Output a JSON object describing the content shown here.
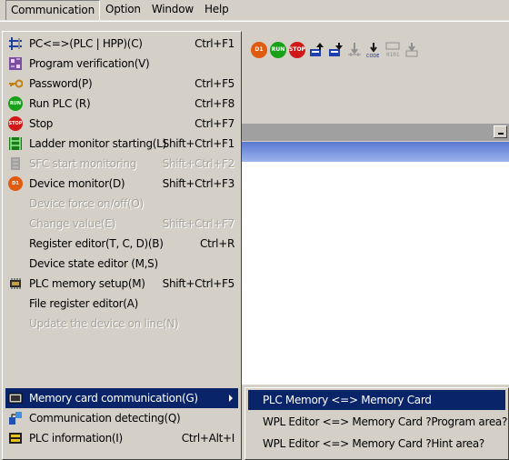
{
  "menubar": {
    "items": [
      {
        "label": "Communication",
        "open": true
      },
      {
        "label": "Option"
      },
      {
        "label": "Window"
      },
      {
        "label": "Help"
      }
    ]
  },
  "toolbar": {
    "icons": [
      "device-monitor-icon",
      "run-plc-icon",
      "stop-plc-icon",
      "upload-icon",
      "download-icon",
      "monitor-write-icon",
      "code-write-icon",
      "bit-write-icon",
      "transfer-icon"
    ]
  },
  "communication_menu": {
    "items": [
      {
        "label": "PC<=>(PLC | HPP)(C)",
        "shortcut": "Ctrl+F1",
        "icon": "pc-plc-transfer-icon",
        "enabled": true
      },
      {
        "label": "Program verification(V)",
        "shortcut": "",
        "icon": "program-verify-icon",
        "enabled": true
      },
      {
        "label": "Password(P)",
        "shortcut": "Ctrl+F5",
        "icon": "key-icon",
        "enabled": true
      },
      {
        "label": "Run PLC (R)",
        "shortcut": "Ctrl+F8",
        "icon": "run-icon",
        "icon_text": "RUN",
        "enabled": true
      },
      {
        "label": "Stop",
        "shortcut": "Ctrl+F7",
        "icon": "stop-icon",
        "icon_text": "STOP",
        "enabled": true
      },
      {
        "label": "Ladder monitor starting(L)",
        "shortcut": "Shift+Ctrl+F1",
        "icon": "ladder-monitor-icon",
        "enabled": true
      },
      {
        "label": "SFC start monitoring",
        "shortcut": "Shift+Ctrl+F2",
        "icon": "sfc-monitor-icon",
        "enabled": false
      },
      {
        "label": "Device monitor(D)",
        "shortcut": "Shift+Ctrl+F3",
        "icon": "device-monitor-icon",
        "icon_text": "D1",
        "enabled": true
      },
      {
        "label": "Device force on/off(O)",
        "shortcut": "",
        "icon": "",
        "enabled": false
      },
      {
        "label": "Change value(E)",
        "shortcut": "Shift+Ctrl+F7",
        "icon": "",
        "enabled": false
      },
      {
        "label": "Register editor(T, C, D)(B)",
        "shortcut": "Ctrl+R",
        "icon": "",
        "enabled": true
      },
      {
        "label": "Device state editor (M,S)",
        "shortcut": "",
        "icon": "",
        "enabled": true
      },
      {
        "label": "PLC memory setup(M)",
        "shortcut": "Shift+Ctrl+F5",
        "icon": "memory-chip-icon",
        "enabled": true
      },
      {
        "label": "File register editor(A)",
        "shortcut": "",
        "icon": "",
        "enabled": true
      },
      {
        "label": "Update the device on line(N)",
        "shortcut": "",
        "icon": "",
        "enabled": false
      },
      {
        "label": "Memory card communication(G)",
        "shortcut": "",
        "icon": "memory-card-icon",
        "enabled": true,
        "highlighted": true,
        "has_submenu": true
      },
      {
        "label": "Communication detecting(Q)",
        "shortcut": "",
        "icon": "communication-detect-icon",
        "enabled": true
      },
      {
        "label": "PLC information(I)",
        "shortcut": "Ctrl+Alt+I",
        "icon": "plc-info-icon",
        "enabled": true
      }
    ]
  },
  "memory_card_submenu": {
    "items": [
      {
        "label": "PLC Memory  <=> Memory Card",
        "highlighted": true
      },
      {
        "label": "WPL Editor <=> Memory Card ?Program area?"
      },
      {
        "label": "WPL Editor <=> Memory Card ?Hint area?"
      }
    ]
  },
  "colors": {
    "menu_bg": "#d4d0c8",
    "highlight": "#0a246a",
    "disabled_text": "#a6a39b",
    "run_green": "#18a018",
    "stop_red": "#d01818",
    "monitor_orange": "#e05a10"
  }
}
